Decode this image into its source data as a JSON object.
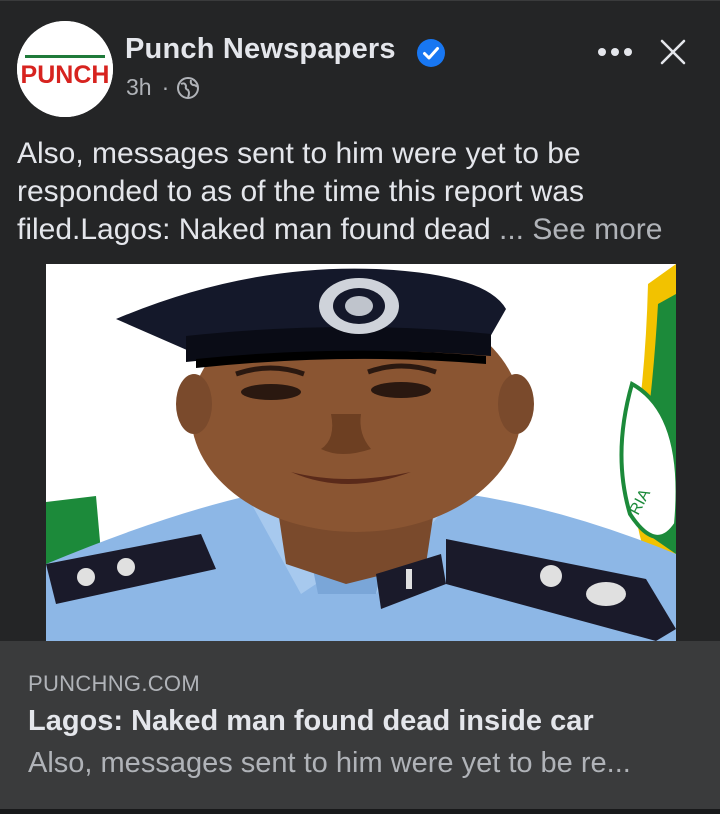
{
  "post": {
    "author": "Punch Newspapers",
    "time": "3h",
    "separator": "·",
    "privacy_icon": "globe-icon",
    "verified_icon": "verified-badge-icon",
    "avatar_logo_text": "PUNCH",
    "more_icon": "more-options-icon",
    "close_icon": "close-icon",
    "text": "Also, messages sent to him were yet to be responded to as of the time this report was filed.Lagos: Naked man found dead ",
    "ellipsis": "...",
    "see_more": "See more"
  },
  "link_preview": {
    "domain": "PUNCHNG.COM",
    "headline": "Lagos: Naked man found dead inside car",
    "snippet": "Also, messages sent to him were yet to be re..."
  },
  "colors": {
    "background": "#242526",
    "link_box": "#3a3b3c",
    "primary_text": "#e4e6eb",
    "secondary_text": "#b0b3b8",
    "verified": "#1877f2",
    "punch_red": "#d7231f"
  }
}
